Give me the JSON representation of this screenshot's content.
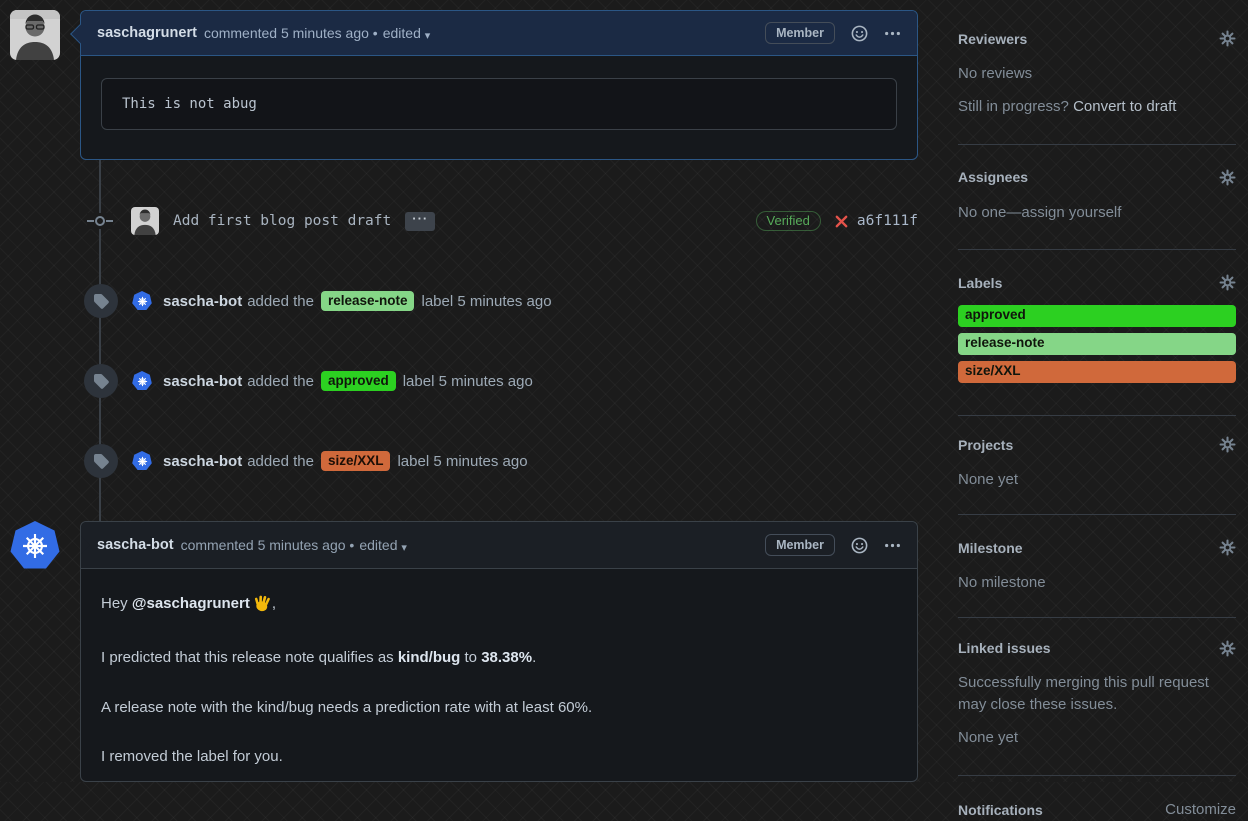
{
  "colors": {
    "page_bg": "#1b1b1b",
    "highlight_border": "#2b5685",
    "highlight_header_bg": "#1b2a44",
    "box_bg": "#15181c",
    "neutral_border": "#3a4148",
    "approved_green": "#2cd021",
    "release_note_green": "#85d687",
    "size_orange": "#d0693b",
    "verified_green": "#57ab5a",
    "x_red": "#e5534b",
    "kubernetes_blue": "#326ce5"
  },
  "comment1": {
    "author": "saschagrunert",
    "meta": "commented 5 minutes ago •",
    "edited": "edited",
    "caret": "▾",
    "badge": "Member",
    "code": "This is not abug"
  },
  "commit": {
    "message": "Add first blog post draft",
    "expander": "···",
    "verified": "Verified",
    "sha": "a6f111f"
  },
  "events": [
    {
      "actor": "sascha-bot",
      "action": "added the",
      "label": "release-note",
      "tail": "label 5 minutes ago"
    },
    {
      "actor": "sascha-bot",
      "action": "added the",
      "label": "approved",
      "tail": "label 5 minutes ago"
    },
    {
      "actor": "sascha-bot",
      "action": "added the",
      "label": "size/XXL",
      "tail": "label 5 minutes ago"
    }
  ],
  "comment2": {
    "author": "sascha-bot",
    "meta": "commented 5 minutes ago •",
    "edited": "edited",
    "caret": "▾",
    "badge": "Member",
    "p1_prefix": "Hey ",
    "p1_mention": "@saschagrunert",
    "p1_emoji": "👋",
    "p1_suffix": ",",
    "p2_a": "I predicted that this release note qualifies as ",
    "p2_b": "kind/bug",
    "p2_c": " to ",
    "p2_d": "38.38%",
    "p2_e": ".",
    "p3": "A release note with the kind/bug needs a prediction rate with at least 60%.",
    "p4": "I removed the label for you."
  },
  "sidebar": {
    "reviewers": {
      "title": "Reviewers",
      "empty": "No reviews",
      "hint": "Still in progress? ",
      "hint_link": "Convert to draft"
    },
    "assignees": {
      "title": "Assignees",
      "empty_prefix": "No one—",
      "empty_link": "assign yourself"
    },
    "labels": {
      "title": "Labels",
      "items": [
        "approved",
        "release-note",
        "size/XXL"
      ]
    },
    "projects": {
      "title": "Projects",
      "empty": "None yet"
    },
    "milestone": {
      "title": "Milestone",
      "empty": "No milestone"
    },
    "linked_issues": {
      "title": "Linked issues",
      "desc": "Successfully merging this pull request may close these issues.",
      "empty": "None yet"
    },
    "notifications": {
      "title": "Notifications",
      "link": "Customize"
    }
  }
}
